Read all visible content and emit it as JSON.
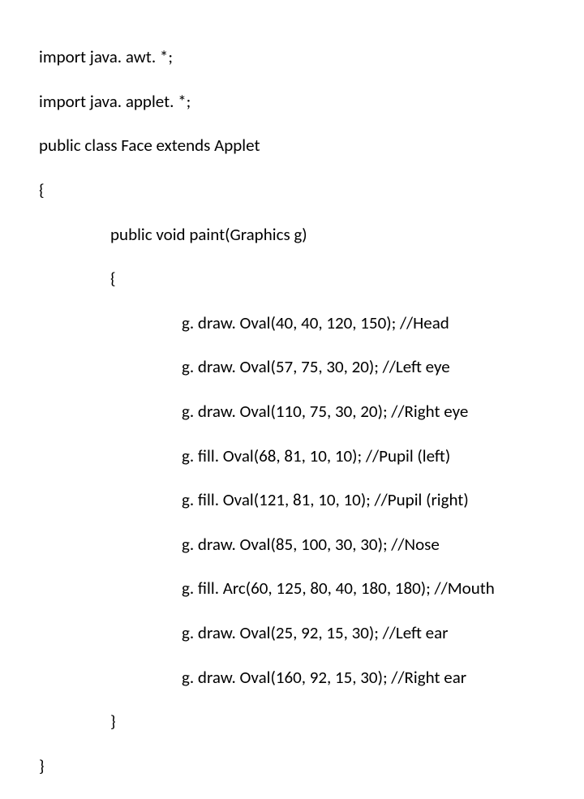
{
  "code": {
    "l1": "import java. awt. *;",
    "l2": "import java. applet. *;",
    "l3": "public class Face extends Applet",
    "l4": "{",
    "l5": "public void paint(Graphics g)",
    "l6": "{",
    "l7": "g. draw. Oval(40, 40, 120, 150); //Head",
    "l8": "g. draw. Oval(57, 75, 30, 20); //Left eye",
    "l9": "g. draw. Oval(110, 75, 30, 20); //Right eye",
    "l10": "g. fill. Oval(68, 81, 10, 10); //Pupil (left)",
    "l11": "g. fill. Oval(121, 81, 10, 10); //Pupil (right)",
    "l12": "g. draw. Oval(85, 100, 30, 30); //Nose",
    "l13": "g. fill. Arc(60, 125, 80, 40, 180, 180); //Mouth",
    "l14": "g. draw. Oval(25, 92, 15, 30); //Left ear",
    "l15": "g. draw. Oval(160, 92, 15, 30); //Right ear",
    "l16": "}",
    "l17": "}"
  }
}
